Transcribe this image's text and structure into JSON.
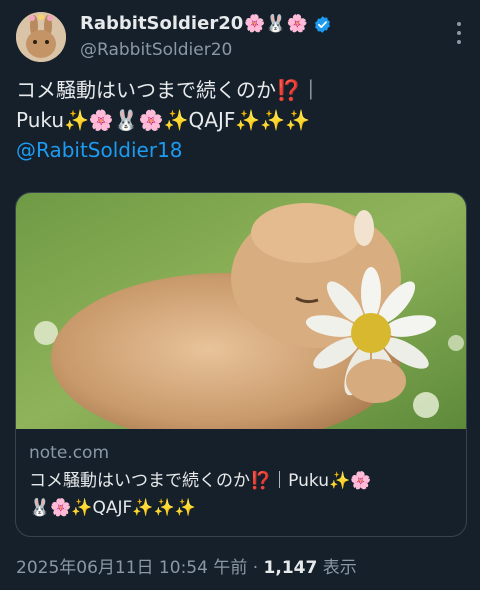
{
  "user": {
    "display_name": "RabbitSoldier20",
    "name_emojis": "🌸🐰🌸",
    "handle": "@RabbitSoldier20"
  },
  "tweet": {
    "line1": "コメ騒動はいつまで続くのか⁉️｜",
    "line2": "Puku✨🌸🐰🌸✨QAJF✨✨✨",
    "mention": "@RabitSoldier18"
  },
  "card": {
    "domain": "note.com",
    "title_line1": "コメ騒動はいつまで続くのか⁉️｜Puku✨🌸",
    "title_line2": "🐰🌸✨QAJF✨✨✨"
  },
  "meta": {
    "timestamp": "2025年06月11日 10:54 午前",
    "separator": " · ",
    "views_count": "1,147",
    "views_label": " 表示"
  }
}
